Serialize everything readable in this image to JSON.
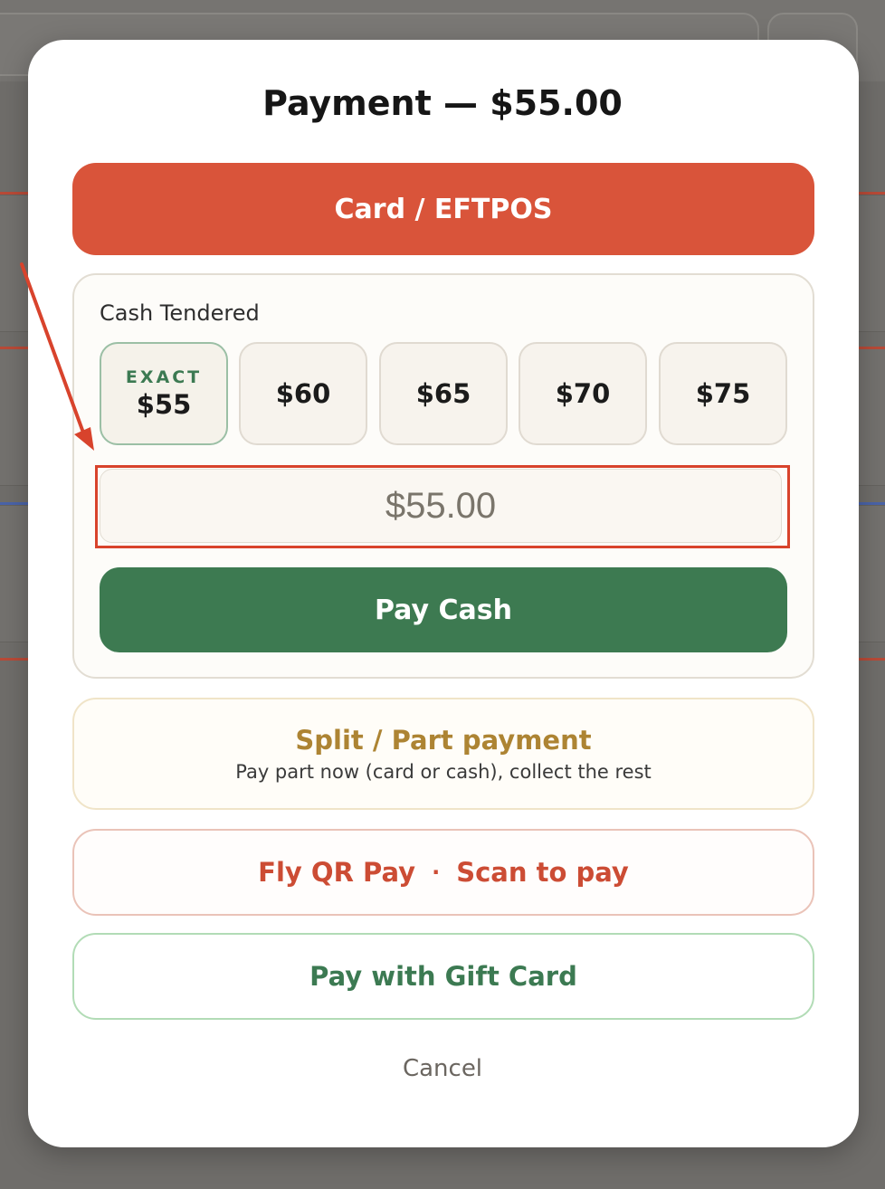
{
  "modal": {
    "title": "Payment — $55.00",
    "card_button": "Card / EFTPOS",
    "cash": {
      "label": "Cash Tendered",
      "exact_tag": "EXACT",
      "chips": [
        "$55",
        "$60",
        "$65",
        "$70",
        "$75"
      ],
      "tendered_placeholder": "$55.00",
      "pay_button": "Pay Cash"
    },
    "split": {
      "title": "Split / Part payment",
      "subtitle": "Pay part now (card or cash), collect the rest"
    },
    "qr": {
      "left": "Fly QR Pay",
      "separator": "·",
      "right": "Scan to pay"
    },
    "gift_button": "Pay with Gift Card",
    "cancel": "Cancel"
  },
  "colors": {
    "card": "#d9543a",
    "cash_green": "#3d7a51",
    "split_gold": "#ad8433",
    "qr_red": "#cc4c34",
    "annotation_red": "#d8432c"
  }
}
